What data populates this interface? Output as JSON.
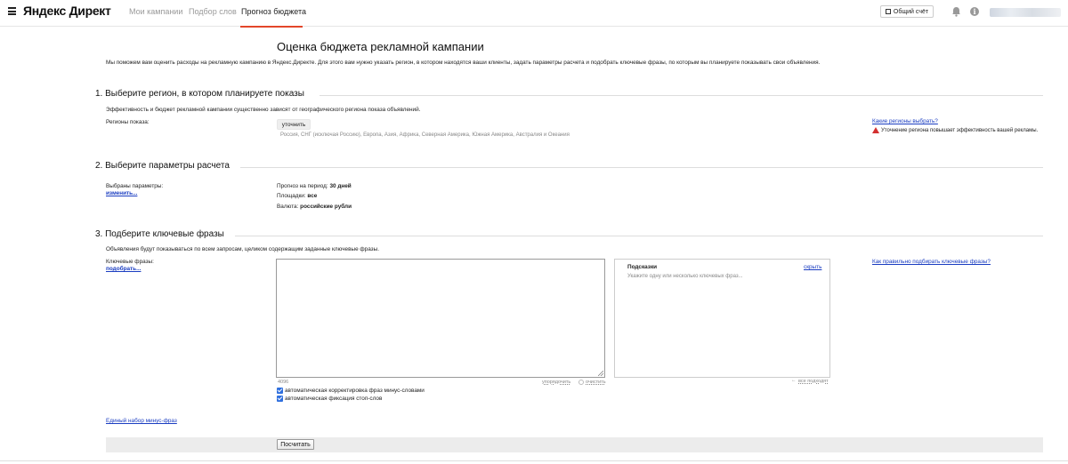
{
  "header": {
    "logo": "Яндекс Директ",
    "tabs": [
      {
        "label": "Мои кампании"
      },
      {
        "label": "Подбор слов"
      },
      {
        "label": "Прогноз бюджета"
      }
    ],
    "account_button": "Общий счёт",
    "icons": [
      "menu-icon",
      "wallet-icon",
      "bell-icon",
      "info-icon"
    ],
    "accent_color": "#e3462a"
  },
  "page": {
    "title": "Оценка бюджета рекламной кампании",
    "intro": "Мы поможем вам оценить расходы на рекламную кампанию в Яндекс.Директе. Для этого вам нужно указать регион, в котором находятся ваши клиенты, задать параметры расчета и подобрать ключевые фразы, по которым вы планируете показывать свои объявления."
  },
  "section1": {
    "title": "1. Выберите регион, в котором планируете показы",
    "description": "Эффективность и бюджет рекламной кампании существенно зависят от географического региона показа объявлений.",
    "regions_label": "Регионы показа:",
    "refine_button": "уточнить",
    "regions_value": "Россия, СНГ (исключая Россию), Европа, Азия, Африка, Северная Америка, Южная Америка, Австралия и Океания",
    "help_link": "Какие регионы выбрать?",
    "warning": "Уточнение региона повышает эффективность вашей рекламы."
  },
  "section2": {
    "title": "2. Выберите параметры расчета",
    "params_label": "Выбраны параметры:",
    "change_link": "изменить...",
    "period_label": "Прогноз на период:",
    "period_value": "30 дней",
    "platforms_label": "Площадки:",
    "platforms_value": "все",
    "currency_label": "Валюта:",
    "currency_value": "российские рубли"
  },
  "section3": {
    "title": "3. Подберите ключевые фразы",
    "description": "Объявления будут показываться по всем запросам, целиком содержащим заданные ключевые фразы.",
    "phrases_label": "Ключевые фразы:",
    "pick_link": "подобрать...",
    "textarea_value": "",
    "char_counter": "4096",
    "sort_link": "упорядочить",
    "clear_link": "очистить",
    "hints_title": "Подсказки",
    "hints_hide": "скрыть",
    "hints_placeholder": "Укажите одну или несколько ключевых фраз...",
    "all_fit": "все подходят",
    "help_link": "Как правильно подбирать ключевые фразы?",
    "checkbox1": "автоматическая корректировка фраз минус-словами",
    "checkbox2": "автоматическая фиксация стоп-слов",
    "checkbox1_checked": true,
    "checkbox2_checked": true
  },
  "footer": {
    "minus_phrases_link": "Единый набор минус-фраз",
    "calculate_button": "Посчитать"
  }
}
